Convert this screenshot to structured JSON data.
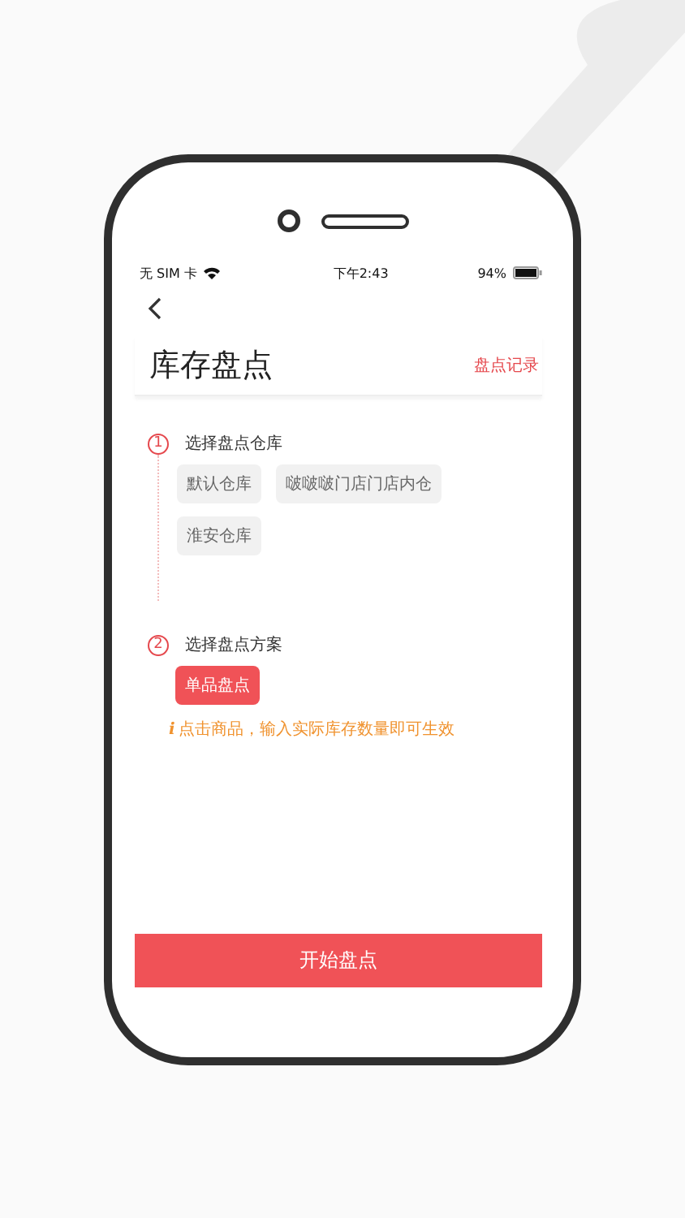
{
  "status_bar": {
    "carrier": "无 SIM 卡",
    "time": "下午2:43",
    "battery": "94%"
  },
  "header": {
    "title": "库存盘点",
    "action": "盘点记录"
  },
  "steps": [
    {
      "number": "1",
      "label": "选择盘点仓库",
      "options": [
        {
          "label": "默认仓库",
          "selected": false
        },
        {
          "label": "啵啵啵门店门店内仓",
          "selected": false
        },
        {
          "label": "淮安仓库",
          "selected": false
        }
      ]
    },
    {
      "number": "2",
      "label": "选择盘点方案",
      "options": [
        {
          "label": "单品盘点",
          "selected": true
        }
      ]
    }
  ],
  "tip": {
    "icon": "i",
    "text": "点击商品，输入实际库存数量即可生效"
  },
  "start_button": "开始盘点"
}
